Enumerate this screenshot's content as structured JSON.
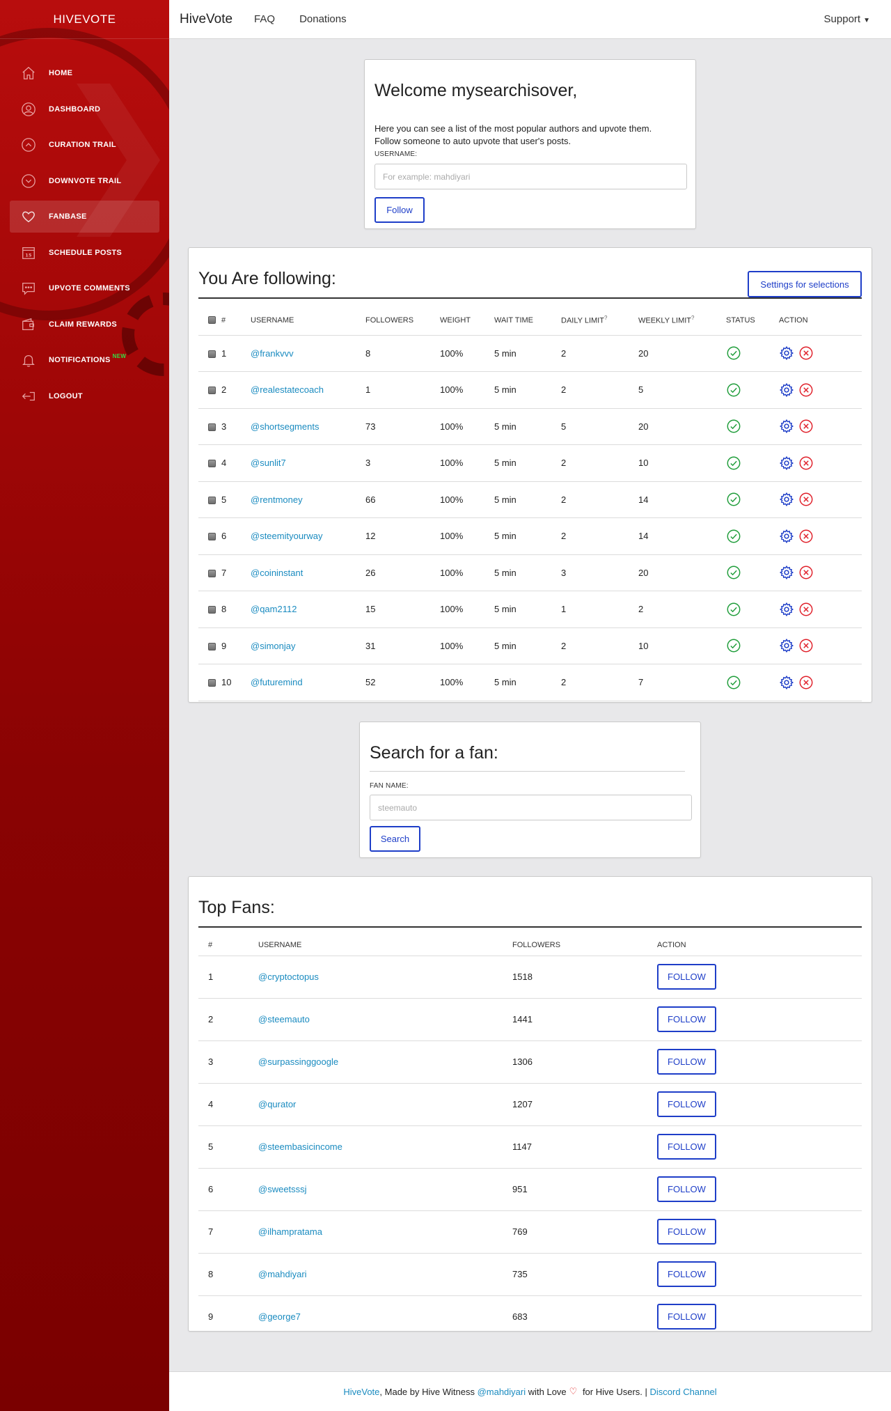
{
  "sidebar": {
    "brand": "HIVEVOTE",
    "items": [
      {
        "label": "HOME",
        "icon": "home-icon"
      },
      {
        "label": "DASHBOARD",
        "icon": "user-icon"
      },
      {
        "label": "CURATION TRAIL",
        "icon": "chevron-up-circle-icon"
      },
      {
        "label": "DOWNVOTE TRAIL",
        "icon": "chevron-down-circle-icon"
      },
      {
        "label": "FANBASE",
        "icon": "heart-icon",
        "active": true
      },
      {
        "label": "SCHEDULE POSTS",
        "icon": "calendar-icon"
      },
      {
        "label": "UPVOTE COMMENTS",
        "icon": "comment-icon"
      },
      {
        "label": "CLAIM REWARDS",
        "icon": "wallet-icon"
      },
      {
        "label": "NOTIFICATIONS",
        "icon": "bell-icon",
        "badge": "NEW"
      },
      {
        "label": "LOGOUT",
        "icon": "logout-icon"
      }
    ],
    "calendar_day": "15"
  },
  "topbar": {
    "title": "HiveVote",
    "links": [
      "FAQ",
      "Donations"
    ],
    "support": "Support"
  },
  "welcome": {
    "title": "Welcome mysearchisover,",
    "desc_line1": "Here you can see a list of the most popular authors and upvote them.",
    "desc_line2": "Follow someone to auto upvote that user's posts.",
    "label": "USERNAME:",
    "placeholder": "For example: mahdiyari",
    "button": "Follow"
  },
  "following": {
    "title": "You Are following:",
    "settings_button": "Settings for selections",
    "columns": [
      "#",
      "USERNAME",
      "FOLLOWERS",
      "WEIGHT",
      "WAIT TIME",
      "DAILY LIMIT",
      "WEEKLY LIMIT",
      "STATUS",
      "ACTION"
    ],
    "help_mark": "?",
    "rows": [
      {
        "n": "1",
        "user": "@frankvvv",
        "followers": "8",
        "weight": "100%",
        "wait": "5 min",
        "daily": "2",
        "weekly": "20"
      },
      {
        "n": "2",
        "user": "@realestatecoach",
        "followers": "1",
        "weight": "100%",
        "wait": "5 min",
        "daily": "2",
        "weekly": "5"
      },
      {
        "n": "3",
        "user": "@shortsegments",
        "followers": "73",
        "weight": "100%",
        "wait": "5 min",
        "daily": "5",
        "weekly": "20"
      },
      {
        "n": "4",
        "user": "@sunlit7",
        "followers": "3",
        "weight": "100%",
        "wait": "5 min",
        "daily": "2",
        "weekly": "10"
      },
      {
        "n": "5",
        "user": "@rentmoney",
        "followers": "66",
        "weight": "100%",
        "wait": "5 min",
        "daily": "2",
        "weekly": "14"
      },
      {
        "n": "6",
        "user": "@steemityourway",
        "followers": "12",
        "weight": "100%",
        "wait": "5 min",
        "daily": "2",
        "weekly": "14"
      },
      {
        "n": "7",
        "user": "@coininstant",
        "followers": "26",
        "weight": "100%",
        "wait": "5 min",
        "daily": "3",
        "weekly": "20"
      },
      {
        "n": "8",
        "user": "@qam2112",
        "followers": "15",
        "weight": "100%",
        "wait": "5 min",
        "daily": "1",
        "weekly": "2"
      },
      {
        "n": "9",
        "user": "@simonjay",
        "followers": "31",
        "weight": "100%",
        "wait": "5 min",
        "daily": "2",
        "weekly": "10"
      },
      {
        "n": "10",
        "user": "@futuremind",
        "followers": "52",
        "weight": "100%",
        "wait": "5 min",
        "daily": "2",
        "weekly": "7"
      }
    ]
  },
  "search": {
    "title": "Search for a fan:",
    "label": "FAN NAME:",
    "placeholder": "steemauto",
    "button": "Search"
  },
  "topfans": {
    "title": "Top Fans:",
    "columns": [
      "#",
      "USERNAME",
      "FOLLOWERS",
      "ACTION"
    ],
    "button": "FOLLOW",
    "rows": [
      {
        "n": "1",
        "user": "@cryptoctopus",
        "followers": "1518"
      },
      {
        "n": "2",
        "user": "@steemauto",
        "followers": "1441"
      },
      {
        "n": "3",
        "user": "@surpassinggoogle",
        "followers": "1306"
      },
      {
        "n": "4",
        "user": "@qurator",
        "followers": "1207"
      },
      {
        "n": "5",
        "user": "@steembasicincome",
        "followers": "1147"
      },
      {
        "n": "6",
        "user": "@sweetsssj",
        "followers": "951"
      },
      {
        "n": "7",
        "user": "@ilhampratama",
        "followers": "769"
      },
      {
        "n": "8",
        "user": "@mahdiyari",
        "followers": "735"
      },
      {
        "n": "9",
        "user": "@george7",
        "followers": "683"
      }
    ]
  },
  "footer": {
    "brand_link": "HiveVote",
    "text1": ", Made by Hive Witness ",
    "witness_link": "@mahdiyari",
    "text2": " with Love",
    "text3": " for Hive Users. | ",
    "discord_link": "Discord Channel"
  },
  "colors": {
    "sidebar_top": "#b80d0d",
    "sidebar_bottom": "#7a0000",
    "accent_button": "#1e3ec8",
    "link": "#1a8bc0",
    "status_ok": "#1f9d3a",
    "action_gear": "#1e3ec8",
    "action_remove": "#e0202a"
  }
}
